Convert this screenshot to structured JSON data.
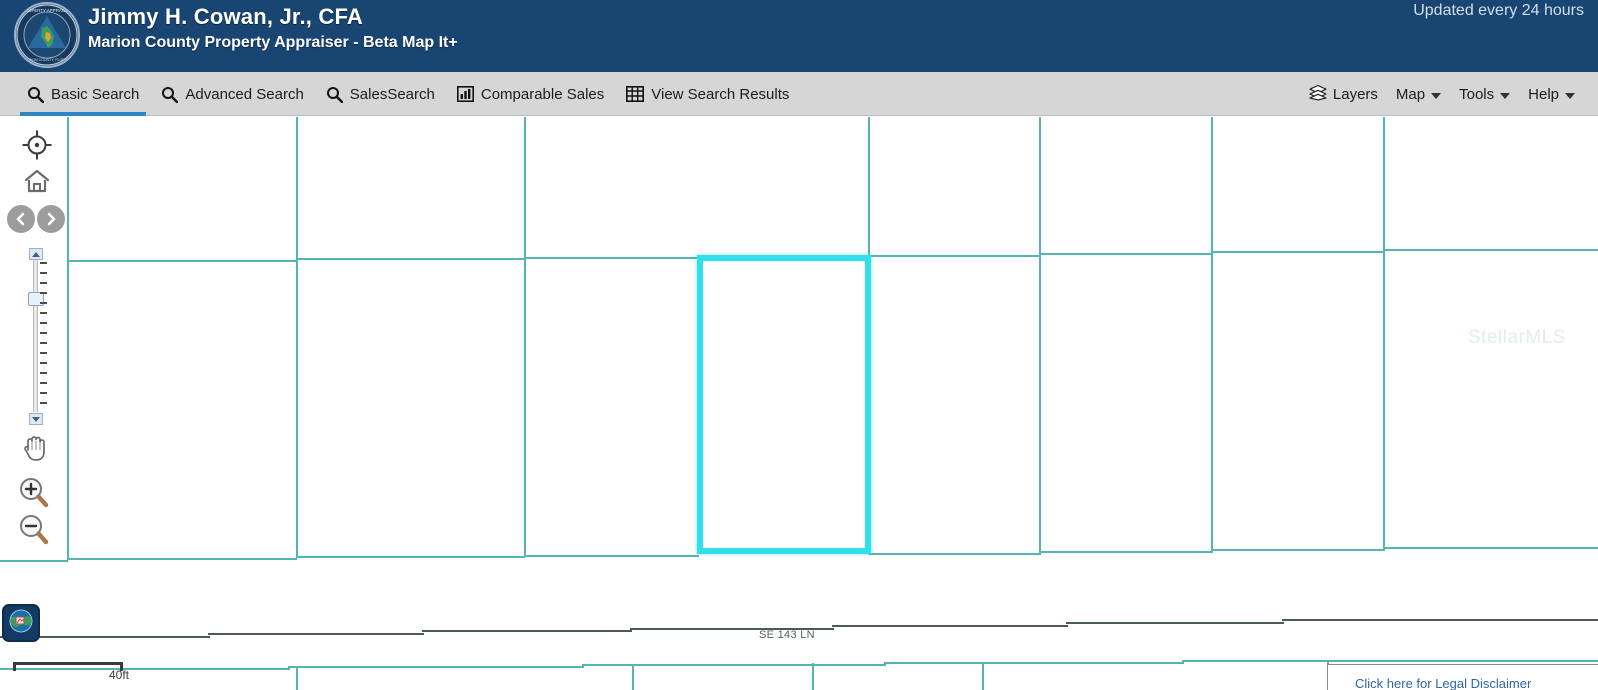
{
  "header": {
    "title": "Jimmy H. Cowan, Jr., CFA",
    "subtitle": "Marion County Property Appraiser - Beta Map It+",
    "updated": "Updated every 24 hours",
    "seal": {
      "top_text": "PROPERTY APPRAISER",
      "bottom_text": "MARION COUNTY, FLORIDA"
    },
    "bg_color": "#194573"
  },
  "navbar": {
    "bg_color": "#d6d6d6",
    "active_indicator_color": "#2e86c8",
    "items": [
      {
        "label": "Basic Search",
        "icon": "search-icon",
        "active": true
      },
      {
        "label": "Advanced Search",
        "icon": "search-icon",
        "active": false
      },
      {
        "label": "SalesSearch",
        "icon": "search-icon",
        "active": false
      },
      {
        "label": "Comparable Sales",
        "icon": "bar-chart-icon",
        "active": false
      },
      {
        "label": "View Search Results",
        "icon": "table-grid-icon",
        "active": false
      }
    ],
    "right_items": [
      {
        "label": "Layers",
        "icon": "layers-icon",
        "dropdown": false
      },
      {
        "label": "Map",
        "icon": "",
        "dropdown": true
      },
      {
        "label": "Tools",
        "icon": "",
        "dropdown": true
      },
      {
        "label": "Help",
        "icon": "",
        "dropdown": true
      }
    ]
  },
  "maptools": {
    "locate_label": "My Location",
    "home_label": "Home Extent",
    "prev_label": "Previous Extent",
    "next_label": "Next Extent",
    "pan_label": "Pan",
    "zoom_in_label": "Zoom In",
    "zoom_out_label": "Zoom Out",
    "zoom_slider_label": "Zoom Level"
  },
  "map": {
    "parcel_line_color": "#54b5b2",
    "road_line_color": "#4c5a5a",
    "selected_parcel_color": "#2fe0ec",
    "street_label": "SE 143 LN",
    "watermark": "StellarMLS",
    "scale_label": "40ft",
    "basemap_label": "Basemap Gallery",
    "disclaimer": "Click here for Legal Disclaimer"
  }
}
